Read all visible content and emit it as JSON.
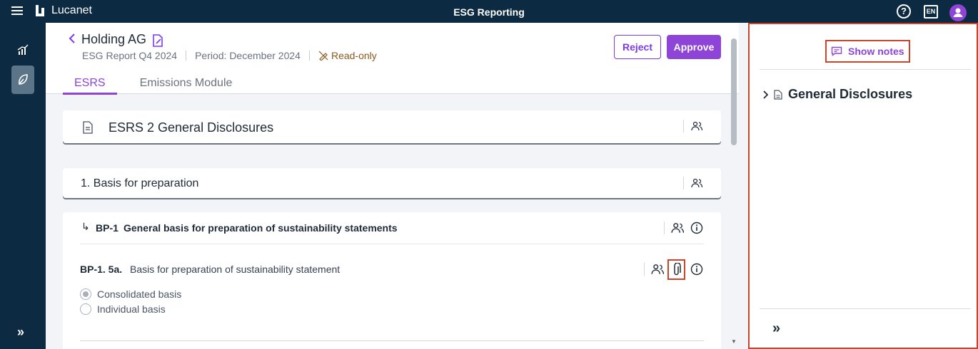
{
  "app": {
    "title": "ESG Reporting",
    "logo_text": "Lucanet",
    "language": "EN",
    "help_label": "?"
  },
  "header": {
    "entity": "Holding AG",
    "report": "ESG Report Q4 2024",
    "period": "Period: December 2024",
    "readonly": "Read-only",
    "reject_label": "Reject",
    "approve_label": "Approve"
  },
  "tabs": [
    {
      "label": "ESRS",
      "active": true
    },
    {
      "label": "Emissions Module",
      "active": false
    }
  ],
  "sections": {
    "esrs2_title": "ESRS 2 General Disclosures",
    "basis_title": "1. Basis for preparation",
    "bp1_code": "BP-1",
    "bp1_title": "General basis for preparation of sustainability statements",
    "bp1_5a_code": "BP-1. 5a.",
    "bp1_5a_title": "Basis for preparation of sustainability statement",
    "options": [
      {
        "label": "Consolidated basis",
        "checked": true
      },
      {
        "label": "Individual basis",
        "checked": false
      }
    ]
  },
  "notes_panel": {
    "show_notes_label": "Show notes",
    "tree_item": "General Disclosures"
  },
  "rail": {
    "expand_label": "»"
  },
  "colors": {
    "topbar": "#0c2a42",
    "accent": "#8e44d6",
    "highlight": "#c9442a"
  }
}
